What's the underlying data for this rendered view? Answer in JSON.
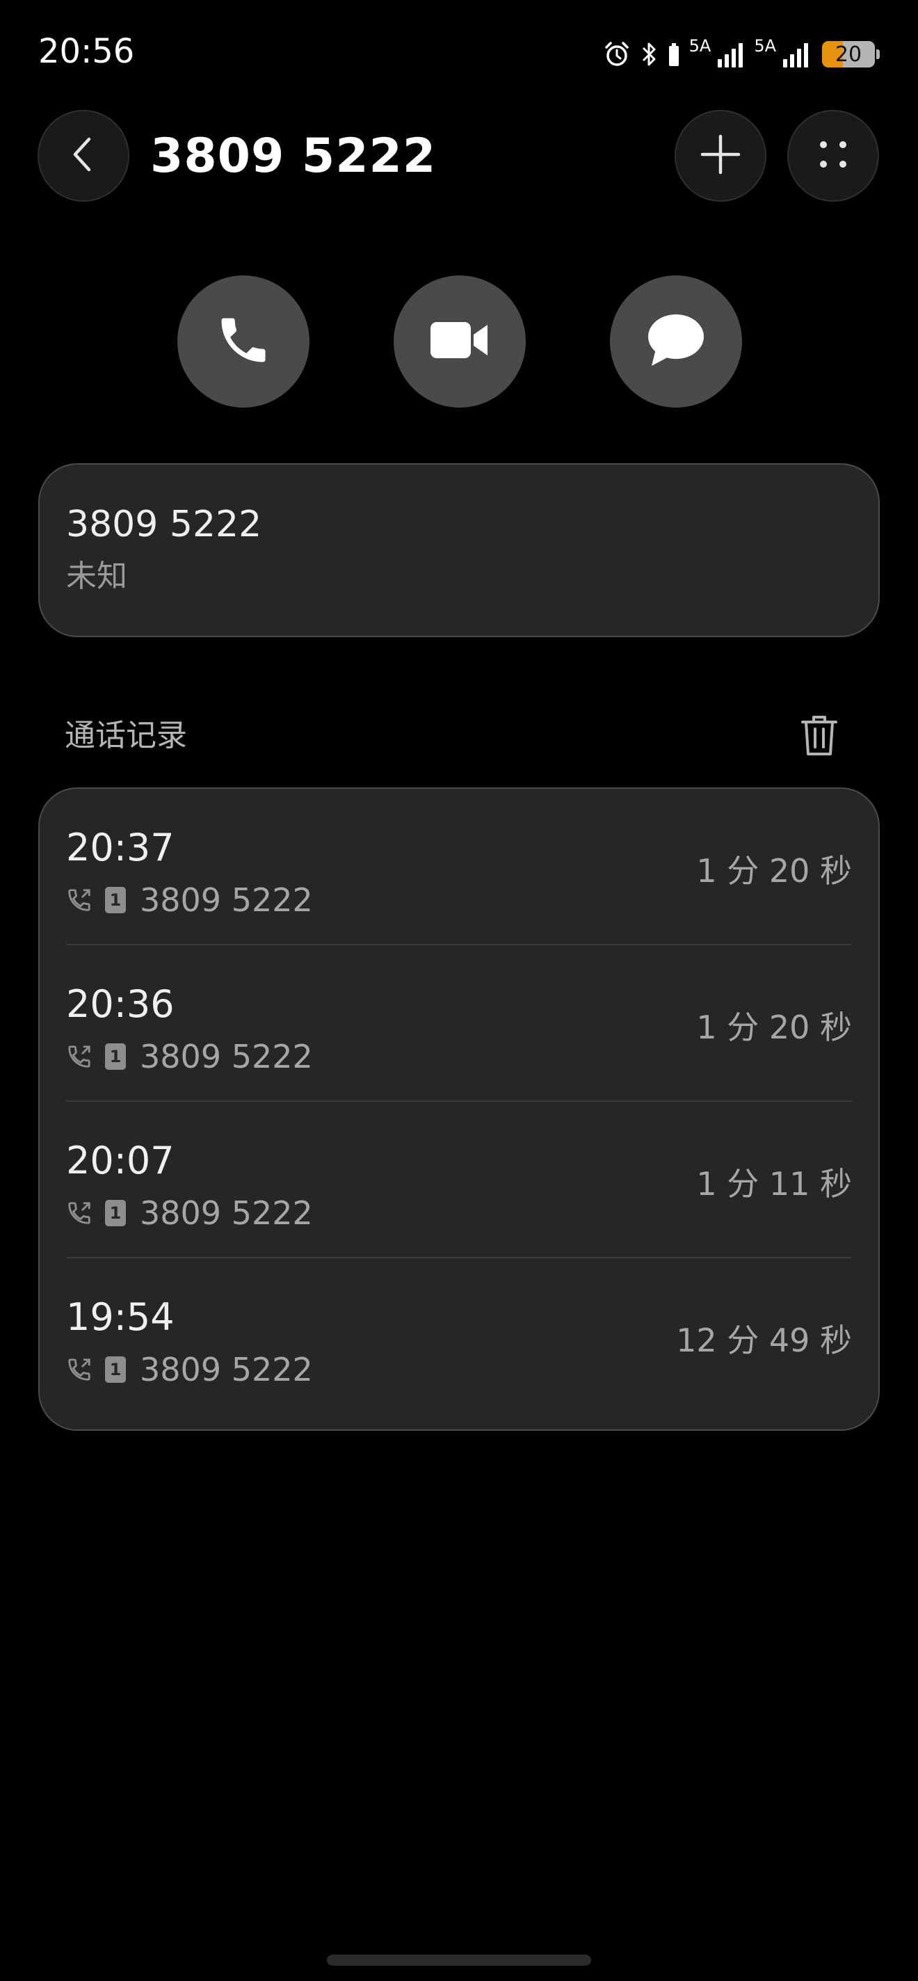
{
  "status_bar": {
    "time": "20:56",
    "network_1": "5A",
    "network_2": "5A",
    "battery_level": "20",
    "icons": [
      "alarm-icon",
      "bluetooth-icon",
      "signal-icon",
      "signal-icon",
      "battery-icon"
    ]
  },
  "header": {
    "title": "3809 5222",
    "icons": [
      "back-chevron-icon",
      "plus-icon",
      "more-dots-icon"
    ]
  },
  "actions": {
    "icons": [
      "phone-icon",
      "video-camera-icon",
      "message-bubble-icon"
    ]
  },
  "contact": {
    "number": "3809 5222",
    "label": "未知"
  },
  "call_log": {
    "title": "通话记录",
    "icon": "trash-icon",
    "entries": [
      {
        "time": "20:37",
        "sim": "1",
        "number": "3809 5222",
        "duration": "1 分 20 秒"
      },
      {
        "time": "20:36",
        "sim": "1",
        "number": "3809 5222",
        "duration": "1 分 20 秒"
      },
      {
        "time": "20:07",
        "sim": "1",
        "number": "3809 5222",
        "duration": "1 分 11 秒"
      },
      {
        "time": "19:54",
        "sim": "1",
        "number": "3809 5222",
        "duration": "12 分 49 秒"
      }
    ]
  },
  "colors": {
    "background": "#000000",
    "card": "#262626",
    "action_button": "#4a4a4a",
    "battery_accent": "#e8930f",
    "secondary_text": "#a6a6a6"
  }
}
